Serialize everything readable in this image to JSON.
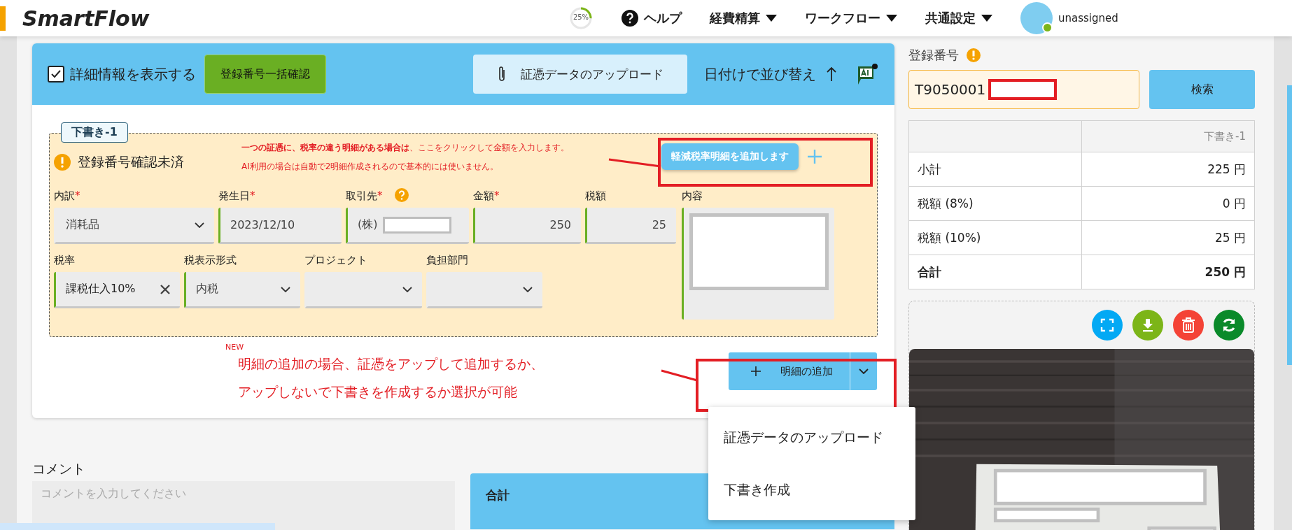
{
  "header": {
    "logo": "SmartFlow",
    "progress": {
      "text": "25%",
      "level": 0.25
    },
    "menu": [
      {
        "label": "ヘルプ",
        "kind": "help"
      },
      {
        "label": "経費精算",
        "kind": "dropdown"
      },
      {
        "label": "ワークフロー",
        "kind": "dropdown"
      },
      {
        "label": "共通設定",
        "kind": "dropdown"
      }
    ],
    "user": {
      "status": "unassigned"
    }
  },
  "toolbar": {
    "show_details": {
      "label": "詳細情報を表示する",
      "checked": true
    },
    "bulk_check": "登録番号一括確認",
    "upload": "証憑データのアップロード",
    "sort": "日付けで並び替え"
  },
  "draft": {
    "tag": "下書き-1",
    "status": "登録番号確認未済",
    "notice": [
      "**一つの証憑に、税率の違う明細がある場合は**、ここをクリックして金額を入力します。",
      "AI利用の場合は自動で2明細作成されるので基本的には使いません。"
    ],
    "reduced_tax_tooltip": "軽減税率明細を追加します",
    "row1": [
      {
        "label": "内訳",
        "mark": "*",
        "kind": "select",
        "value": "消耗品",
        "filled": false
      },
      {
        "label": "発生日",
        "mark": "*",
        "kind": "text",
        "value": "2023/12/10",
        "filled": true
      },
      {
        "label": "取引先",
        "mark": "*",
        "kind": "partner",
        "value": "(株)",
        "filled": true
      },
      {
        "label": "金額",
        "mark": "*",
        "kind": "number",
        "value": "250",
        "filled": true
      },
      {
        "label": "税額",
        "kind": "number",
        "value": "25",
        "filled": true
      }
    ],
    "row2": [
      {
        "label": "税率",
        "kind": "chip",
        "value": "課税仕入10%",
        "filled": true
      },
      {
        "label": "税表示形式",
        "kind": "select",
        "value": "内税",
        "filled": true
      },
      {
        "label": "プロジェクト",
        "kind": "select",
        "filled": false
      },
      {
        "label": "負担部門",
        "kind": "select",
        "filled": false
      }
    ],
    "content": {
      "label": "内容",
      "filled": true
    }
  },
  "add_line": {
    "new_badge": "NEW",
    "button": "明細の追加",
    "annotation": [
      "明細の追加の場合、証憑をアップして追加するか、",
      "アップしないで下書きを作成するか選択が可能"
    ]
  },
  "add_menu": [
    "証憑データのアップロード",
    "下書き作成"
  ],
  "comment": {
    "label": "コメント",
    "placeholder": "コメントを入力してください"
  },
  "total_panel": {
    "title": "合計"
  },
  "registration": {
    "label": "登録番号",
    "value": "T9050001",
    "search": "検索"
  },
  "summary": {
    "column": "下書き-1",
    "rows": [
      {
        "label": "小計",
        "value": "225 円",
        "bold": false
      },
      {
        "label": "税額 (8%)",
        "value": "0 円",
        "bold": false
      },
      {
        "label": "税額 (10%)",
        "value": "25 円",
        "bold": false
      },
      {
        "label": "合計",
        "value": "250 円",
        "bold": true
      }
    ]
  },
  "image_actions": [
    {
      "kind": "expand"
    },
    {
      "kind": "download"
    },
    {
      "kind": "delete"
    },
    {
      "kind": "refresh"
    }
  ]
}
